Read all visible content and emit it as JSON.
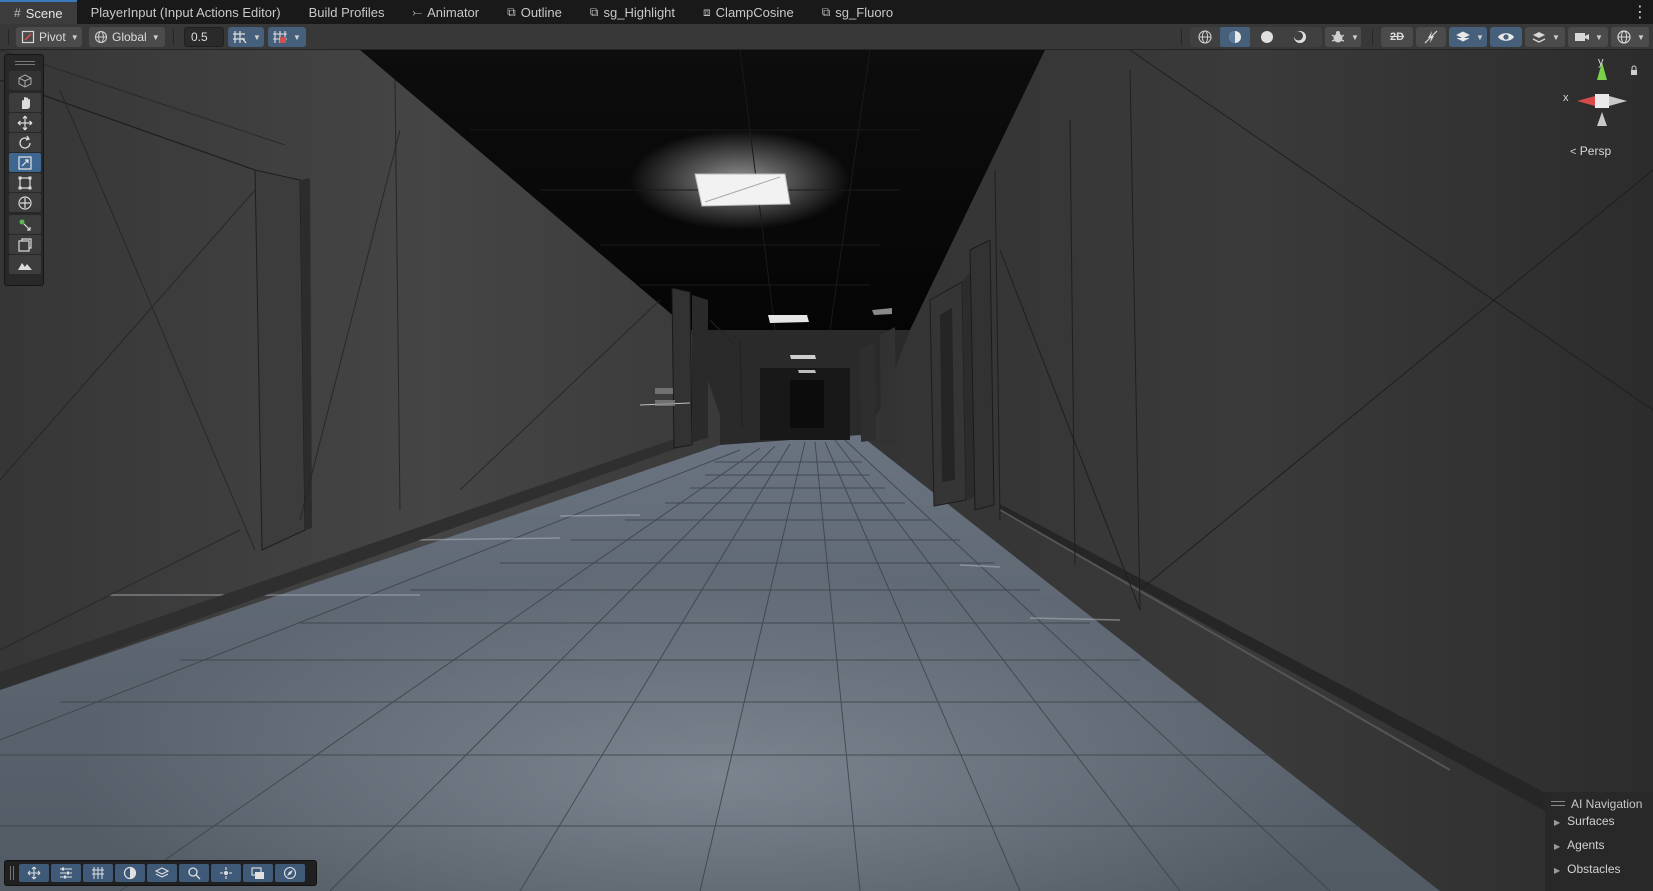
{
  "tabs": [
    {
      "label": "Scene",
      "icon": "hash-icon",
      "active": true
    },
    {
      "label": "PlayerInput (Input Actions Editor)",
      "icon": "",
      "active": false
    },
    {
      "label": "Build Profiles",
      "icon": "",
      "active": false
    },
    {
      "label": "Animator",
      "icon": "animator-icon",
      "active": false
    },
    {
      "label": "Outline",
      "icon": "shadergraph-icon",
      "active": false
    },
    {
      "label": "sg_Highlight",
      "icon": "shadergraph-icon",
      "active": false
    },
    {
      "label": "ClampCosine",
      "icon": "subgraph-icon",
      "active": false
    },
    {
      "label": "sg_Fluoro",
      "icon": "shadergraph-icon",
      "active": false
    }
  ],
  "toolbar": {
    "pivot_label": "Pivot",
    "global_label": "Global",
    "snap_value": "0.5"
  },
  "gizmo": {
    "y_label": "y",
    "x_label": "x",
    "projection_label": "Persp"
  },
  "ai_navigation": {
    "title": "AI Navigation",
    "items": [
      "Surfaces",
      "Agents",
      "Obstacles"
    ]
  },
  "colors": {
    "accent": "#3a79bb",
    "selected": "#46607c",
    "gizmo_x": "#d64a4a",
    "gizmo_y": "#7bd14a"
  }
}
